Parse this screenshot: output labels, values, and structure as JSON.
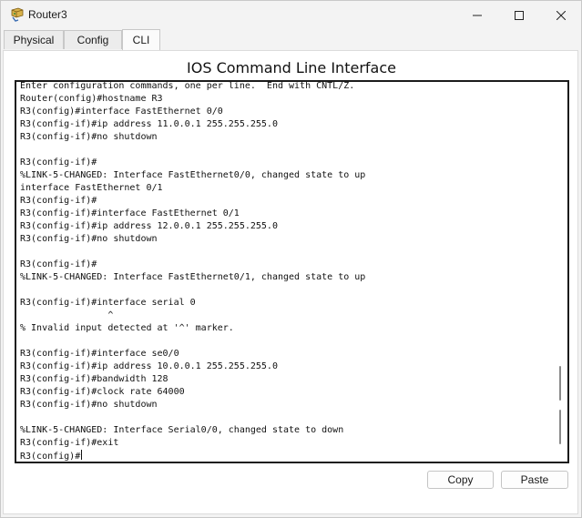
{
  "window": {
    "title": "Router3",
    "app_icon": "router-icon",
    "controls": [
      "minimize-icon",
      "maximize-icon",
      "close-icon"
    ]
  },
  "tabs": [
    {
      "label": "Physical",
      "active": false
    },
    {
      "label": "Config",
      "active": false
    },
    {
      "label": "CLI",
      "active": true
    }
  ],
  "cli": {
    "heading": "IOS Command Line Interface",
    "lines": [
      "Enter configuration commands, one per line.  End with CNTL/Z.",
      "Router(config)#hostname R3",
      "R3(config)#interface FastEthernet 0/0",
      "R3(config-if)#ip address 11.0.0.1 255.255.255.0",
      "R3(config-if)#no shutdown",
      "",
      "R3(config-if)#",
      "%LINK-5-CHANGED: Interface FastEthernet0/0, changed state to up",
      "interface FastEthernet 0/1",
      "R3(config-if)#",
      "R3(config-if)#interface FastEthernet 0/1",
      "R3(config-if)#ip address 12.0.0.1 255.255.255.0",
      "R3(config-if)#no shutdown",
      "",
      "R3(config-if)#",
      "%LINK-5-CHANGED: Interface FastEthernet0/1, changed state to up",
      "",
      "R3(config-if)#interface serial 0",
      "                ^",
      "% Invalid input detected at '^' marker.",
      "",
      "R3(config-if)#interface se0/0",
      "R3(config-if)#ip address 10.0.0.1 255.255.255.0",
      "R3(config-if)#bandwidth 128",
      "R3(config-if)#clock rate 64000",
      "R3(config-if)#no shutdown",
      "",
      "%LINK-5-CHANGED: Interface Serial0/0, changed state to down",
      "R3(config-if)#exit",
      "R3(config)#"
    ]
  },
  "buttons": {
    "copy": "Copy",
    "paste": "Paste"
  }
}
